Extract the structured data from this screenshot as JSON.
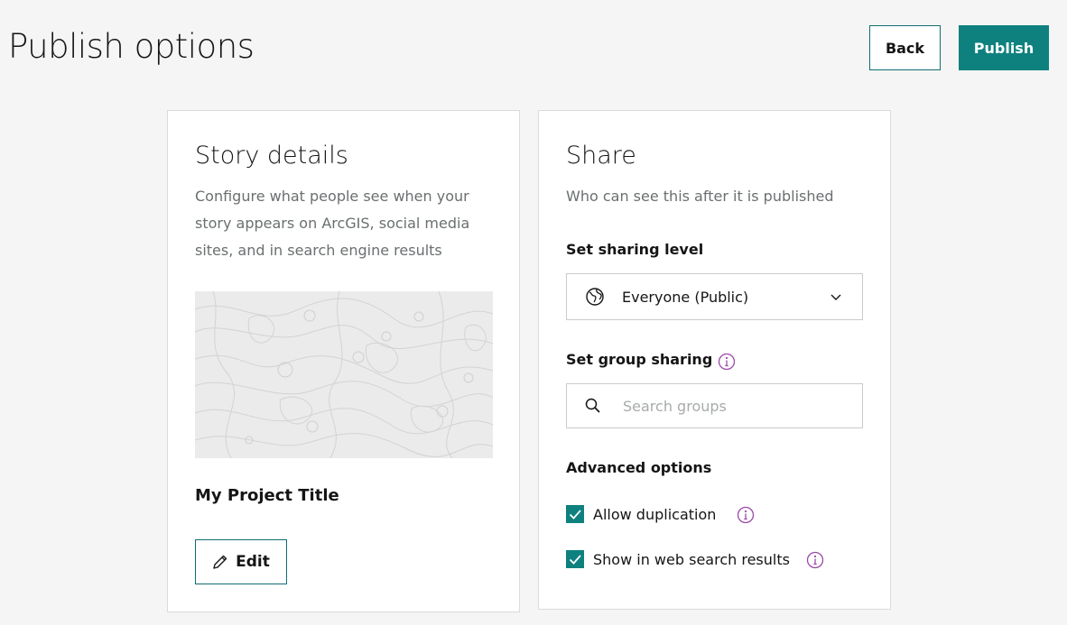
{
  "header": {
    "title": "Publish options",
    "back_label": "Back",
    "publish_label": "Publish"
  },
  "story": {
    "title": "Story details",
    "description": "Configure what people see when your story appears on ArcGIS, social media sites, and in search engine results",
    "project_title": "My Project Title",
    "edit_label": "Edit"
  },
  "share": {
    "title": "Share",
    "subtitle": "Who can see this after it is published",
    "sharing_level_label": "Set sharing level",
    "sharing_level_value": "Everyone (Public)",
    "group_sharing_label": "Set group sharing",
    "search_placeholder": "Search groups",
    "advanced_label": "Advanced options",
    "options": [
      {
        "label": "Allow duplication",
        "checked": true
      },
      {
        "label": "Show in web search results",
        "checked": true
      }
    ]
  },
  "colors": {
    "accent": "#0e817f",
    "info": "#9c4aa9",
    "background": "#f4f5f4"
  },
  "icons": [
    "globe-icon",
    "chevron-down-icon",
    "search-icon",
    "info-icon",
    "pencil-icon",
    "check-icon"
  ]
}
